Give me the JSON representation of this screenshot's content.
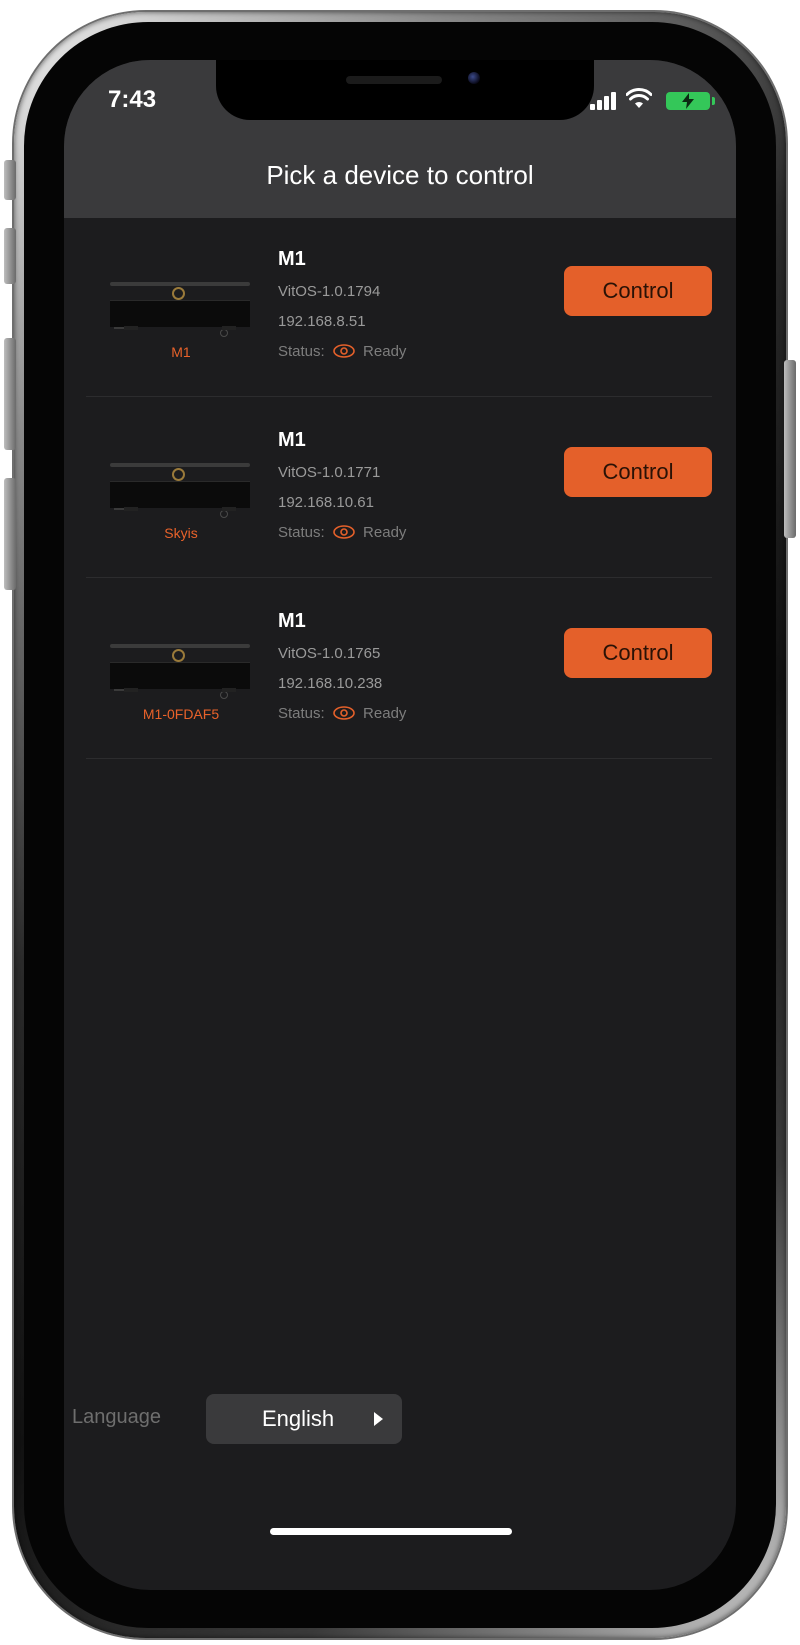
{
  "status_bar": {
    "time": "7:43"
  },
  "header": {
    "title": "Pick a device to control"
  },
  "devices": [
    {
      "name": "M1",
      "model": "M1",
      "firmware": "VitOS-1.0.1794",
      "ip": "192.168.8.51",
      "status_label": "Status:",
      "status_value": "Ready",
      "action_label": "Control"
    },
    {
      "name": "Skyis",
      "model": "M1",
      "firmware": "VitOS-1.0.1771",
      "ip": "192.168.10.61",
      "status_label": "Status:",
      "status_value": "Ready",
      "action_label": "Control"
    },
    {
      "name": "M1-0FDAF5",
      "model": "M1",
      "firmware": "VitOS-1.0.1765",
      "ip": "192.168.10.238",
      "status_label": "Status:",
      "status_value": "Ready",
      "action_label": "Control"
    }
  ],
  "language": {
    "label": "Language",
    "value": "English"
  },
  "colors": {
    "accent": "#e4602a",
    "background": "#1c1c1e",
    "header": "#3a3a3c"
  }
}
